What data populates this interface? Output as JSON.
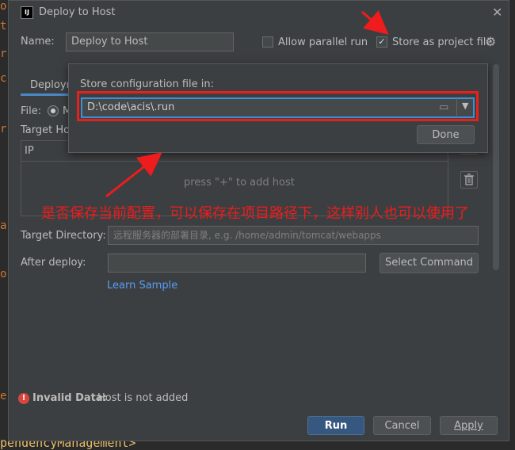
{
  "dialog": {
    "title": "Deploy to Host",
    "name_label": "Name:",
    "name_value": "Deploy to Host",
    "allow_parallel_label": "Allow parallel run",
    "store_project_label": "Store as project file",
    "tab_partial": "Deploym",
    "file_label": "File:",
    "file_option_partial": "M",
    "target_hosts_label": "Target Hos",
    "ip_header": "IP",
    "host_table_hint": "press \"+\" to add host",
    "target_dir_label": "Target Directory:",
    "target_dir_placeholder": "远程服务器的部署目录, e.g. /home/admin/tomcat/webapps",
    "after_deploy_label": "After deploy:",
    "after_deploy_value": "",
    "select_command_label": "Select Command",
    "learn_sample_label": "Learn Sample",
    "error_title": "Invalid Data:",
    "error_message": "Host is not added",
    "run_label": "Run",
    "cancel_label": "Cancel",
    "apply_label": "Apply"
  },
  "popup": {
    "label": "Store configuration file in:",
    "path": "D:\\code\\acis\\.run",
    "done_label": "Done"
  },
  "annotation": {
    "text": "是否保存当前配置，可以保存在项目路径下，这样别人也可以使用了"
  },
  "background": {
    "code_bottom": "pendencyManagement>"
  },
  "icons": [
    "intellij-logo-icon",
    "close-icon",
    "gear-icon",
    "folder-icon",
    "dropdown-arrow-icon",
    "trash-icon",
    "add-icon",
    "error-icon",
    "red-arrow"
  ],
  "colors": {
    "dialog_bg": "#3c3f41",
    "primary_button": "#365880",
    "link": "#589df6",
    "annotation_red": "#ee1c1c",
    "focus_blue": "#3d8fd6"
  }
}
